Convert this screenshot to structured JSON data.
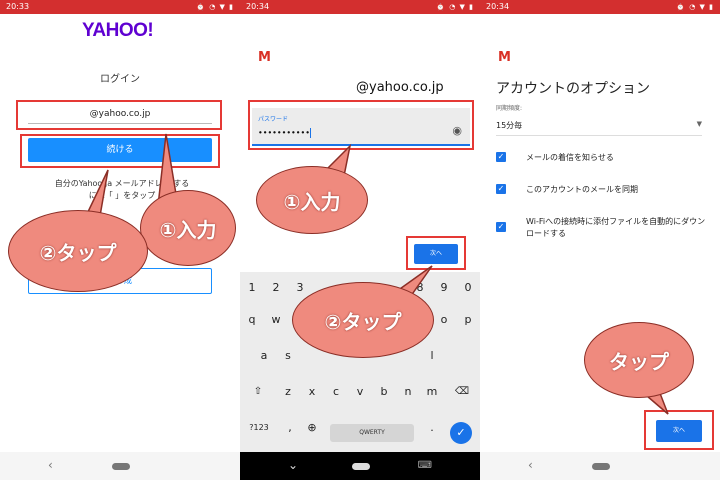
{
  "panel1": {
    "status_time": "20:33",
    "status_icons": "⏰ ◔ ▼ ▮",
    "logo": "YAHOO!",
    "login_title": "ログイン",
    "email_value": "@yahoo.co.jp",
    "continue_label": "続ける",
    "help_line1": "自分のYahoo Ja     メールアドレス     する",
    "help_line2": "には「     」をタップ",
    "create_label": "    の作成",
    "callout_input": "①入力",
    "callout_tap": "②タップ",
    "nav_back": "‹"
  },
  "panel2": {
    "status_time": "20:34",
    "status_icons": "⏰ ◔ ▼ ▮",
    "gmail_icon": "M",
    "email": "@yahoo.co.jp",
    "password_label": "パスワード",
    "password_value": "•••••••••••",
    "eye_icon": "◉",
    "next_label": "次へ",
    "callout_input": "①入力",
    "callout_tap": "②タップ",
    "keyboard": {
      "row_numbers": [
        "1",
        "2",
        "3",
        "",
        "",
        "",
        "",
        "8",
        "9",
        "0"
      ],
      "row_q": [
        "q",
        "w",
        "",
        "",
        "",
        "",
        "",
        "",
        "o",
        "p"
      ],
      "row_a": [
        "a",
        "s",
        "",
        "",
        "",
        "",
        "",
        "",
        "l"
      ],
      "row_z": [
        "⇧",
        "z",
        "x",
        "c",
        "v",
        "b",
        "n",
        "m",
        "⌫"
      ],
      "sym_key": "?123",
      "comma_key": ",",
      "globe_key": "⊕",
      "space_label": "QWERTY",
      "period_key": ".",
      "enter_key": "✓"
    },
    "nav_back": "⌄",
    "nav_kb": "⌨"
  },
  "panel3": {
    "status_time": "20:34",
    "status_icons": "⏰ ◔ ▼ ▮",
    "gmail_icon": "M",
    "title": "アカウントのオプション",
    "sync_label": "同期頻度:",
    "sync_value": "15分毎",
    "dropdown_icon": "▼",
    "options": [
      {
        "checked": "✓",
        "label": "メールの着信を知らせる"
      },
      {
        "checked": "✓",
        "label": "このアカウントのメールを同期"
      },
      {
        "checked": "✓",
        "label": "Wi-Fiへの接続時に添付ファイルを自動的にダウンロードする"
      }
    ],
    "next_label": "次へ",
    "callout_tap": "タップ",
    "nav_back": "‹"
  },
  "colors": {
    "status_bar": "#d32f2f",
    "accent_blue": "#1a73e8",
    "highlight_red": "#e53935",
    "callout_fill": "#ef8a7e"
  }
}
